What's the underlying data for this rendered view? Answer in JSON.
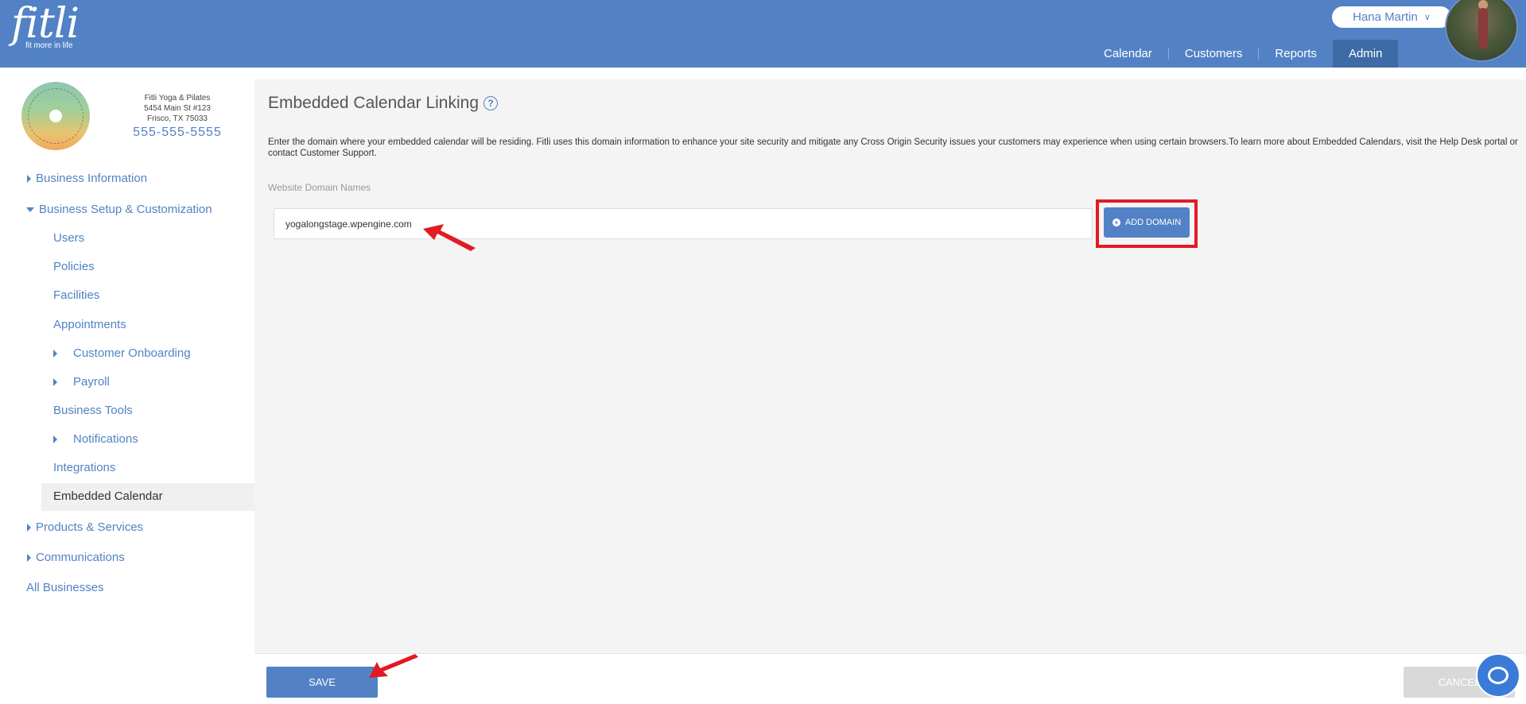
{
  "header": {
    "logo_word": "fitli",
    "logo_tagline": "fit more in life",
    "user_name": "Hana Martin",
    "nav": [
      "Calendar",
      "Customers",
      "Reports",
      "Admin"
    ],
    "active_nav": "Admin"
  },
  "business": {
    "name": "Fitli Yoga & Pilates",
    "address1": "5454 Main St #123",
    "address2": "Frisco, TX 75033",
    "phone": "555-555-5555"
  },
  "sidebar": {
    "items": [
      {
        "label": "Business Information"
      },
      {
        "label": "Business Setup & Customization"
      },
      {
        "label": "Users"
      },
      {
        "label": "Policies"
      },
      {
        "label": "Facilities"
      },
      {
        "label": "Appointments"
      },
      {
        "label": "Customer Onboarding"
      },
      {
        "label": "Payroll"
      },
      {
        "label": "Business Tools"
      },
      {
        "label": "Notifications"
      },
      {
        "label": "Integrations"
      },
      {
        "label": "Embedded Calendar"
      },
      {
        "label": "Products & Services"
      },
      {
        "label": "Communications"
      },
      {
        "label": "All Businesses"
      }
    ]
  },
  "main": {
    "title": "Embedded Calendar Linking",
    "description": "Enter the domain where your embedded calendar will be residing. Fitli uses this domain information to enhance your site security and mitigate any Cross Origin Security issues your customers may experience when using certain browsers.To learn more about Embedded Calendars, visit the Help Desk portal or contact Customer Support.",
    "field_label": "Website Domain Names",
    "domain_value": "yogalongstage.wpengine.com",
    "add_domain_label": "ADD DOMAIN"
  },
  "footer": {
    "save_label": "SAVE",
    "cancel_label": "CANCEL"
  },
  "colors": {
    "brand": "#5282c5",
    "highlight": "#e21b23"
  }
}
